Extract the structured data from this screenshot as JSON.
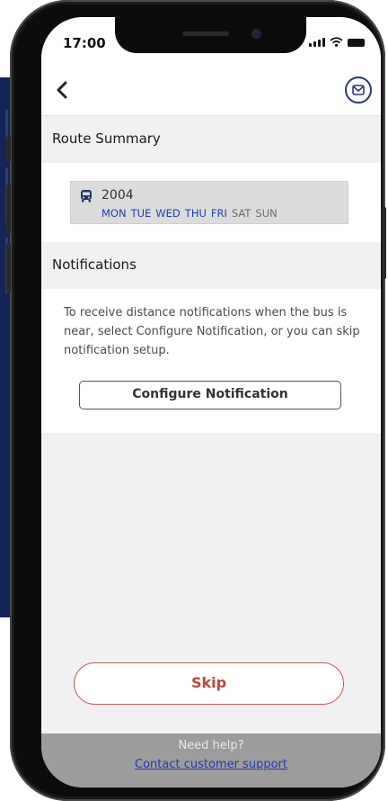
{
  "status_bar": {
    "time": "17:00"
  },
  "header": {
    "back_icon": "chevron-left-icon",
    "mail_icon": "envelope-icon"
  },
  "route_summary": {
    "title": "Route Summary",
    "route": {
      "icon": "bus-icon",
      "number": "2004",
      "days": [
        {
          "label": "MON",
          "active": true
        },
        {
          "label": "TUE",
          "active": true
        },
        {
          "label": "WED",
          "active": true
        },
        {
          "label": "THU",
          "active": true
        },
        {
          "label": "FRI",
          "active": true
        },
        {
          "label": "SAT",
          "active": false
        },
        {
          "label": "SUN",
          "active": false
        }
      ]
    }
  },
  "notifications": {
    "title": "Notifications",
    "description": "To receive distance notifications when the bus is near, select Configure Notification, or you can skip notification setup.",
    "configure_label": "Configure Notification"
  },
  "footer": {
    "skip_label": "Skip",
    "help_text": "Need help?",
    "support_link": "Contact customer support"
  },
  "colors": {
    "accent_blue": "#1f3bb3",
    "skip_red": "#c0453b",
    "navy": "#2a3a6e"
  }
}
